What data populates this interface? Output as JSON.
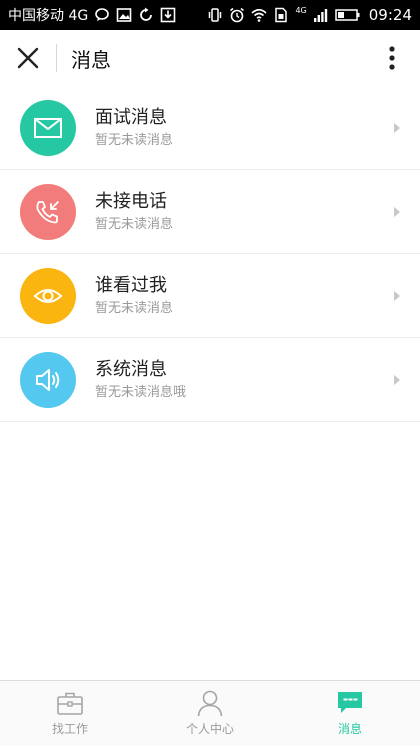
{
  "status_bar": {
    "carrier": "中国移动 4G",
    "network": "4G",
    "time": "09:24"
  },
  "header": {
    "title": "消息",
    "close_icon": "close-icon",
    "more_icon": "more-vertical-icon"
  },
  "messages": [
    {
      "title": "面试消息",
      "subtitle": "暂无未读消息",
      "icon": "envelope-icon",
      "color": "#25c8a2"
    },
    {
      "title": "未接电话",
      "subtitle": "暂无未读消息",
      "icon": "missed-call-icon",
      "color": "#f27c7c"
    },
    {
      "title": "谁看过我",
      "subtitle": "暂无未读消息",
      "icon": "eye-icon",
      "color": "#fbb511"
    },
    {
      "title": "系统消息",
      "subtitle": "暂无未读消息哦",
      "icon": "speaker-icon",
      "color": "#55c8f0"
    }
  ],
  "bottom_nav": [
    {
      "label": "找工作",
      "icon": "briefcase-icon",
      "active": false
    },
    {
      "label": "个人中心",
      "icon": "person-icon",
      "active": false
    },
    {
      "label": "消息",
      "icon": "chat-bubble-icon",
      "active": true
    }
  ],
  "colors": {
    "accent": "#25c8a2",
    "inactive": "#9a9a9a"
  }
}
